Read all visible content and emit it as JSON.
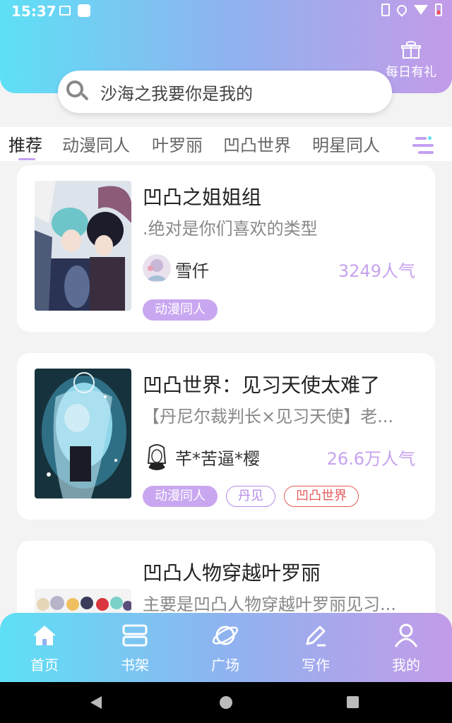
{
  "status_bar": {
    "time": "15:37"
  },
  "header": {
    "gift_label": "每日有礼"
  },
  "search": {
    "placeholder": "沙海之我要你是我的"
  },
  "tabs": [
    {
      "label": "推荐",
      "active": true
    },
    {
      "label": "动漫同人"
    },
    {
      "label": "叶罗丽"
    },
    {
      "label": "凹凸世界"
    },
    {
      "label": "明星同人"
    }
  ],
  "colors": {
    "accent": "#c49ff0",
    "gradient_start": "#5ee0f5",
    "gradient_end": "#c39be8",
    "tag_red": "#e35b5b"
  },
  "books": [
    {
      "title": "凹凸之姐姐组",
      "desc": ".绝对是你们喜欢的类型",
      "author": "雪仟",
      "popularity": "3249人气",
      "tags": [
        {
          "label": "动漫同人",
          "style": "filled"
        }
      ]
    },
    {
      "title": "凹凸世界：见习天使太难了",
      "desc": "【丹尼尔裁判长×见习天使】老...",
      "author": "芊*苦逼*樱",
      "popularity": "26.6万人气",
      "tags": [
        {
          "label": "动漫同人",
          "style": "filled"
        },
        {
          "label": "丹见",
          "style": "outline-purple"
        },
        {
          "label": "凹凸世界",
          "style": "outline-red"
        }
      ]
    },
    {
      "title": "凹凸人物穿越叶罗丽",
      "desc": "主要是凹凸人物穿越叶罗丽见习..."
    }
  ],
  "bottom_nav": [
    {
      "label": "首页",
      "icon": "home-icon"
    },
    {
      "label": "书架",
      "icon": "bookshelf-icon"
    },
    {
      "label": "广场",
      "icon": "planet-icon"
    },
    {
      "label": "写作",
      "icon": "pencil-icon"
    },
    {
      "label": "我的",
      "icon": "user-icon"
    }
  ]
}
